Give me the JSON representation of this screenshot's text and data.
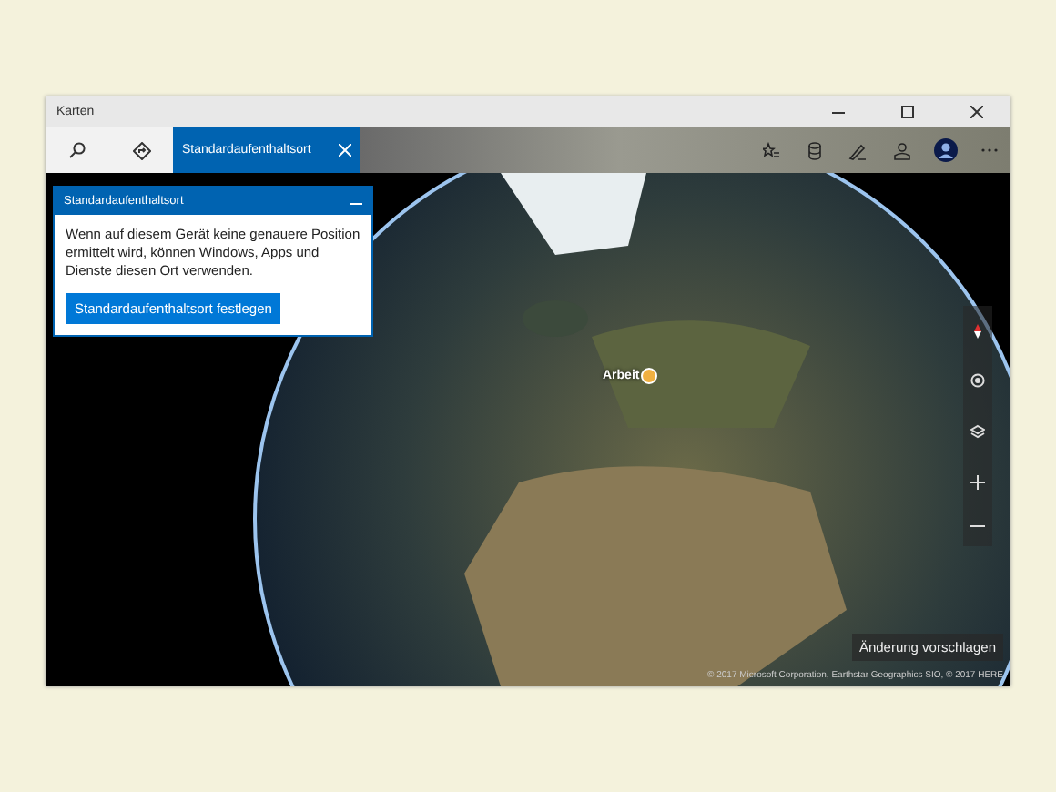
{
  "window": {
    "title": "Karten"
  },
  "toolbar": {
    "tab": {
      "label": "Standardaufenthaltsort",
      "selected": true
    }
  },
  "panel": {
    "title": "Standardaufenthaltsort",
    "text": "Wenn auf diesem Gerät keine genauere Position ermittelt wird, können Windows, Apps und Dienste diesen Ort verwenden.",
    "button": "Standardaufenthaltsort festlegen"
  },
  "map": {
    "pin_label": "Arbeit",
    "suggest_button": "Änderung vorschlagen",
    "copyright": "© 2017 Microsoft Corporation, Earthstar Geographics SIO, © 2017 HERE"
  }
}
